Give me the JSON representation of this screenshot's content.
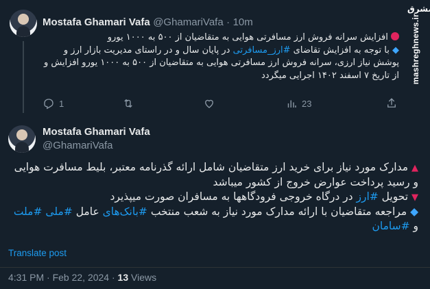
{
  "tweet1": {
    "author_name": "Mostafa Ghamari Vafa",
    "handle": "@GhamariVafa",
    "separator": "·",
    "time": "10m",
    "lines": [
      {
        "prefix": "red-dot",
        "text": "افزایش سرانه فروش ارز مسافرتی هوایی به متقاضیان از ۵۰۰ به ۱۰۰۰ یورو"
      },
      {
        "prefix": "diamond",
        "before": "با توجه به افزایش تقاضای ",
        "hashtag": "#ارز_مسافرتی",
        "after": " در پایان سال و در راستای مدیریت بازار ارز و پوشش نیاز ارزی، سرانه فروش ارز مسافرتی هوایی به متقاضیان از ۵۰۰ به ۱۰۰۰ یورو افزایش و از تاریخ ۷ اسفند ۱۴۰۲ اجرایی میگردد"
      }
    ],
    "actions": {
      "reply_count": "1",
      "retweet_count": "",
      "like_count": "",
      "views_count": "23"
    }
  },
  "tweet2": {
    "author_name": "Mostafa Ghamari Vafa",
    "handle": "@GhamariVafa",
    "p1_text": "مدارک مورد نیاز برای خرید ارز متقاضیان شامل ارائه گذرنامه معتبر، بلیط مسافرت هوایی و رسید پرداخت عوارض خروج از کشور میباشد",
    "p2_before": "تحویل ",
    "p2_hashtag": "#ارز",
    "p2_after": " در درگاه خروجی فرودگاهها به مسافران صورت میپذیرد",
    "p3_before": "مراجعه متقاضیان با ارائه مدارک مورد نیاز به شعب منتخب ",
    "p3_hashtag1": "#بانک‌های",
    "p3_mid": " عامل ",
    "p3_hashtag2": "#ملی",
    "p3_space": " ",
    "p3_hashtag3": "#ملت",
    "p3_and": " و ",
    "p3_hashtag4": "#سامان",
    "translate_label": "Translate post",
    "time": "4:31 PM · Feb 22, 2024",
    "views_sep": " · ",
    "views_count": "13",
    "views_label": " Views"
  },
  "watermark": {
    "logo_text": "مشرق",
    "url": "mashreghnews.ir"
  },
  "colors": {
    "background": "#15202b",
    "accent": "#1d9bf0",
    "muted": "#8b98a5",
    "red": "#e0245e",
    "diamond": "#3ea6ff"
  },
  "icons": [
    "reply-icon",
    "retweet-icon",
    "like-icon",
    "views-icon",
    "share-icon"
  ]
}
